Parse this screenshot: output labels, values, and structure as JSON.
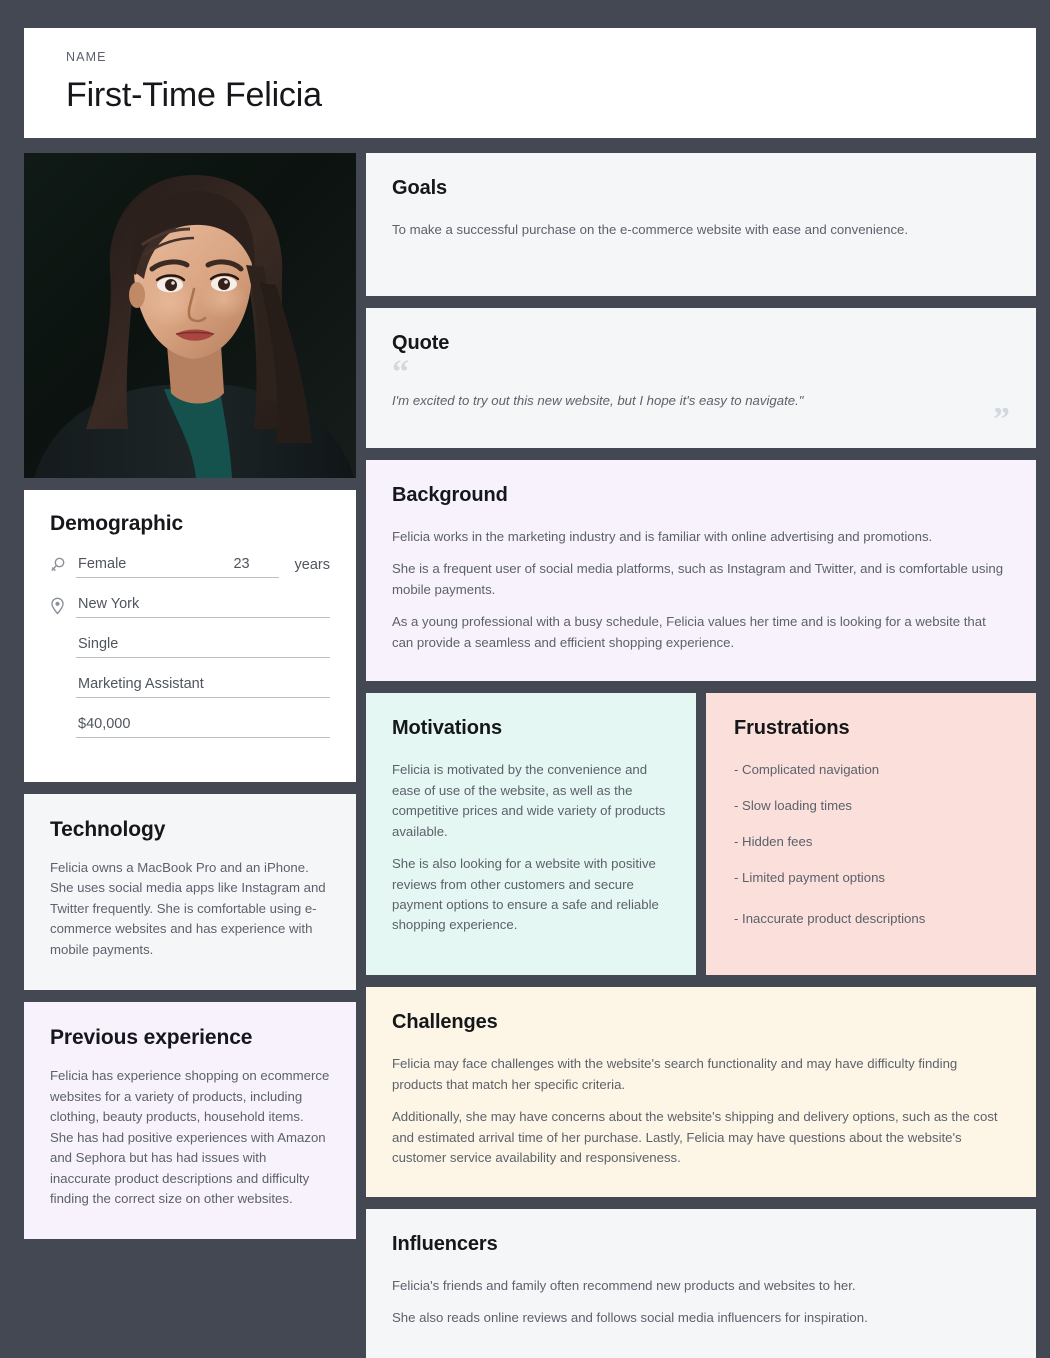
{
  "header": {
    "label": "NAME",
    "value": "First-Time Felicia"
  },
  "photo": {
    "alt": "Portrait photo of a smiling young woman with long dark hair against a dark background"
  },
  "demographic": {
    "title": "Demographic",
    "gender": "Female",
    "age": "23",
    "age_unit": "years",
    "location": "New York",
    "status": "Single",
    "occupation": "Marketing Assistant",
    "income": "$40,000"
  },
  "technology": {
    "title": "Technology",
    "body": "Felicia owns a MacBook Pro and an iPhone. She uses social media apps like Instagram and Twitter frequently. She is comfortable using e-commerce websites and has experience with mobile payments."
  },
  "previous_experience": {
    "title": "Previous experience",
    "body": "Felicia has experience shopping on ecommerce websites for a variety of products, including clothing, beauty products, household items. She has had positive experiences with Amazon and Sephora but has had issues with inaccurate product descriptions and difficulty finding the correct size on other websites."
  },
  "goals": {
    "title": "Goals",
    "body": "To make a successful purchase on the e-commerce website with ease and convenience."
  },
  "quote": {
    "title": "Quote",
    "open_mark": "“",
    "close_mark": "”",
    "text": "I'm excited to try out this new website, but I hope it's easy to navigate.\""
  },
  "background": {
    "title": "Background",
    "paragraphs": [
      "Felicia works in the marketing industry and is familiar with online advertising and promotions.",
      "She is a frequent user of social media platforms, such as Instagram and Twitter, and is comfortable using mobile payments.",
      "As a young professional with a busy schedule, Felicia values her time and is looking for a website that can provide a seamless and efficient shopping experience."
    ]
  },
  "motivations": {
    "title": "Motivations",
    "paragraphs": [
      "Felicia is motivated by the convenience and ease of use of the website, as well as the competitive prices and wide variety of products available.",
      "She is also looking for a website with positive reviews from other customers and secure payment options to ensure a safe and reliable shopping experience."
    ]
  },
  "frustrations": {
    "title": "Frustrations",
    "items": [
      "- Complicated navigation",
      "- Slow loading times",
      "- Hidden fees",
      "- Limited payment options",
      "- Inaccurate product descriptions"
    ]
  },
  "challenges": {
    "title": "Challenges",
    "paragraphs": [
      "Felicia may face challenges with the website's search functionality and may have difficulty finding products that match her specific criteria.",
      "Additionally, she may have concerns about the website's shipping and delivery options, such as the cost and estimated arrival time of her purchase. Lastly, Felicia may have questions about the website's customer service availability and responsiveness."
    ]
  },
  "influencers": {
    "title": "Influencers",
    "paragraphs": [
      "Felicia's friends and family often recommend new products and websites to her.",
      "She also reads online reviews and follows social media influencers for inspiration."
    ]
  },
  "colors": {
    "board_background": "#434852",
    "card_white": "#ffffff",
    "card_gray": "#f5f6f8",
    "card_lavender": "#f7f2fc",
    "card_mint": "#e5f7f2",
    "card_pink": "#fadfda",
    "card_cream": "#fdf6e6",
    "title_text": "#15171b",
    "body_text": "#5c616b"
  }
}
